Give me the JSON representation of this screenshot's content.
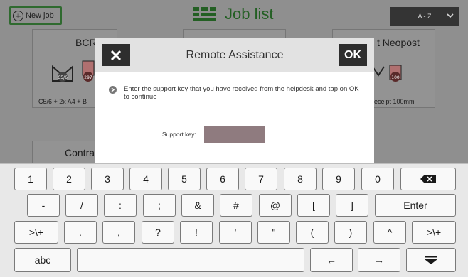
{
  "header": {
    "new_job_label": "New job",
    "title": "Job list",
    "sort_value": "A - Z"
  },
  "jobs": [
    {
      "title": "BCR",
      "subtitle": "C5/6 + 2x A4 + B"
    },
    {
      "title": "t  Neopost",
      "subtitle": "eceipt 100mm"
    },
    {
      "title": "Contra",
      "subtitle": ""
    }
  ],
  "dialog": {
    "title": "Remote Assistance",
    "ok_label": "OK",
    "instructions": "Enter the support key that you have received from the helpdesk and tap on OK to continue",
    "support_key_label": "Support key:",
    "support_key_value": ""
  },
  "keyboard": {
    "row1": [
      "1",
      "2",
      "3",
      "4",
      "5",
      "6",
      "7",
      "8",
      "9",
      "0"
    ],
    "row2": [
      "-",
      "/",
      ":",
      ";",
      "&",
      "#",
      "@",
      "[",
      "]"
    ],
    "enter_label": "Enter",
    "row3": [
      ">\\+",
      ".",
      ",",
      "?",
      "!",
      "'",
      "\"",
      "(",
      ")",
      "^",
      ">\\+"
    ],
    "abc_label": "abc",
    "left_arrow": "←",
    "right_arrow": "→"
  },
  "colors": {
    "accent_green": "#235f23",
    "dialog_header": "#e2e2e2",
    "button_dark": "#2e2e2e",
    "support_key_field": "#8f7b7f"
  }
}
